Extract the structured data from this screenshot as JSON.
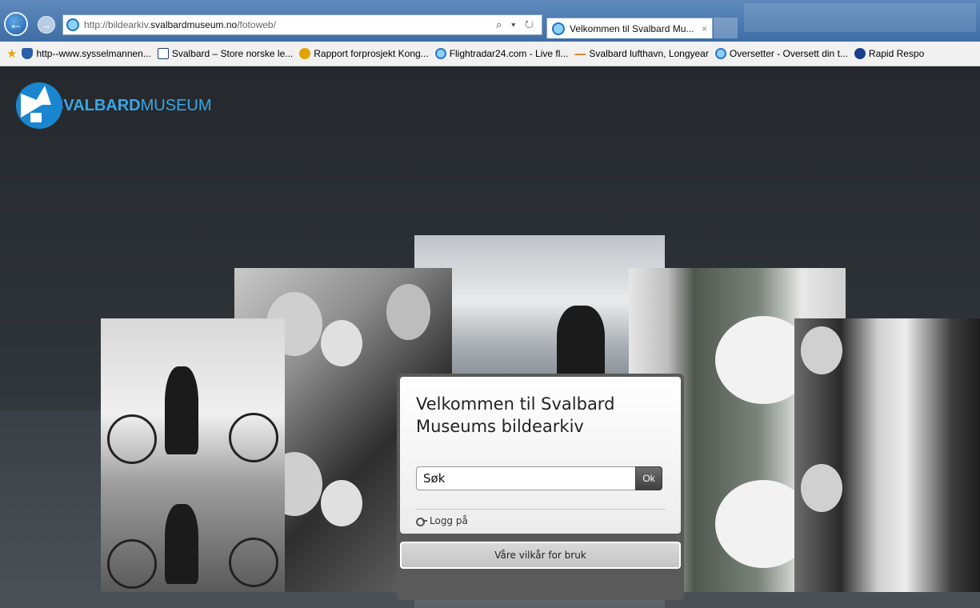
{
  "browser": {
    "url_prefix": "http://bildearkiv.",
    "url_domain": "svalbardmuseum.no",
    "url_path": "/fotoweb/",
    "address_tools": "⌕ ▾ ↻",
    "tab_title": "Velkommen til Svalbard Mu...",
    "tab_close": "×",
    "back_icon": "←",
    "forward_icon": "→"
  },
  "favorites": [
    {
      "label": "http--www.sysselmannen...",
      "icon_color": "#2a5fa8"
    },
    {
      "label": "Svalbard – Store norske le...",
      "icon_color": "#1f3d6e"
    },
    {
      "label": "Rapport forprosjekt Kong...",
      "icon_color": "#e0a300"
    },
    {
      "label": "Flightradar24.com - Live fl...",
      "icon_color": "#2b79c9"
    },
    {
      "label": "Svalbard lufthavn, Longyear",
      "icon_color": "#e07a1a"
    },
    {
      "label": "Oversetter - Oversett din t...",
      "icon_color": "#2b79c9"
    },
    {
      "label": "Rapid Respo",
      "icon_color": "#1a3f8f"
    }
  ],
  "logo": {
    "text_bold": "SVALBARD",
    "text_light": "MUSEUM"
  },
  "dialog": {
    "welcome": "Velkommen til Svalbard Museums bildearkiv",
    "search_value": "Søk",
    "ok_label": "Ok",
    "login_label": "Logg på",
    "terms_label": "Våre vilkår for bruk"
  },
  "colors": {
    "page_bg": "#2b3034",
    "logo_blue": "#3aa5e6",
    "ok_button": "#4f4f4f"
  }
}
